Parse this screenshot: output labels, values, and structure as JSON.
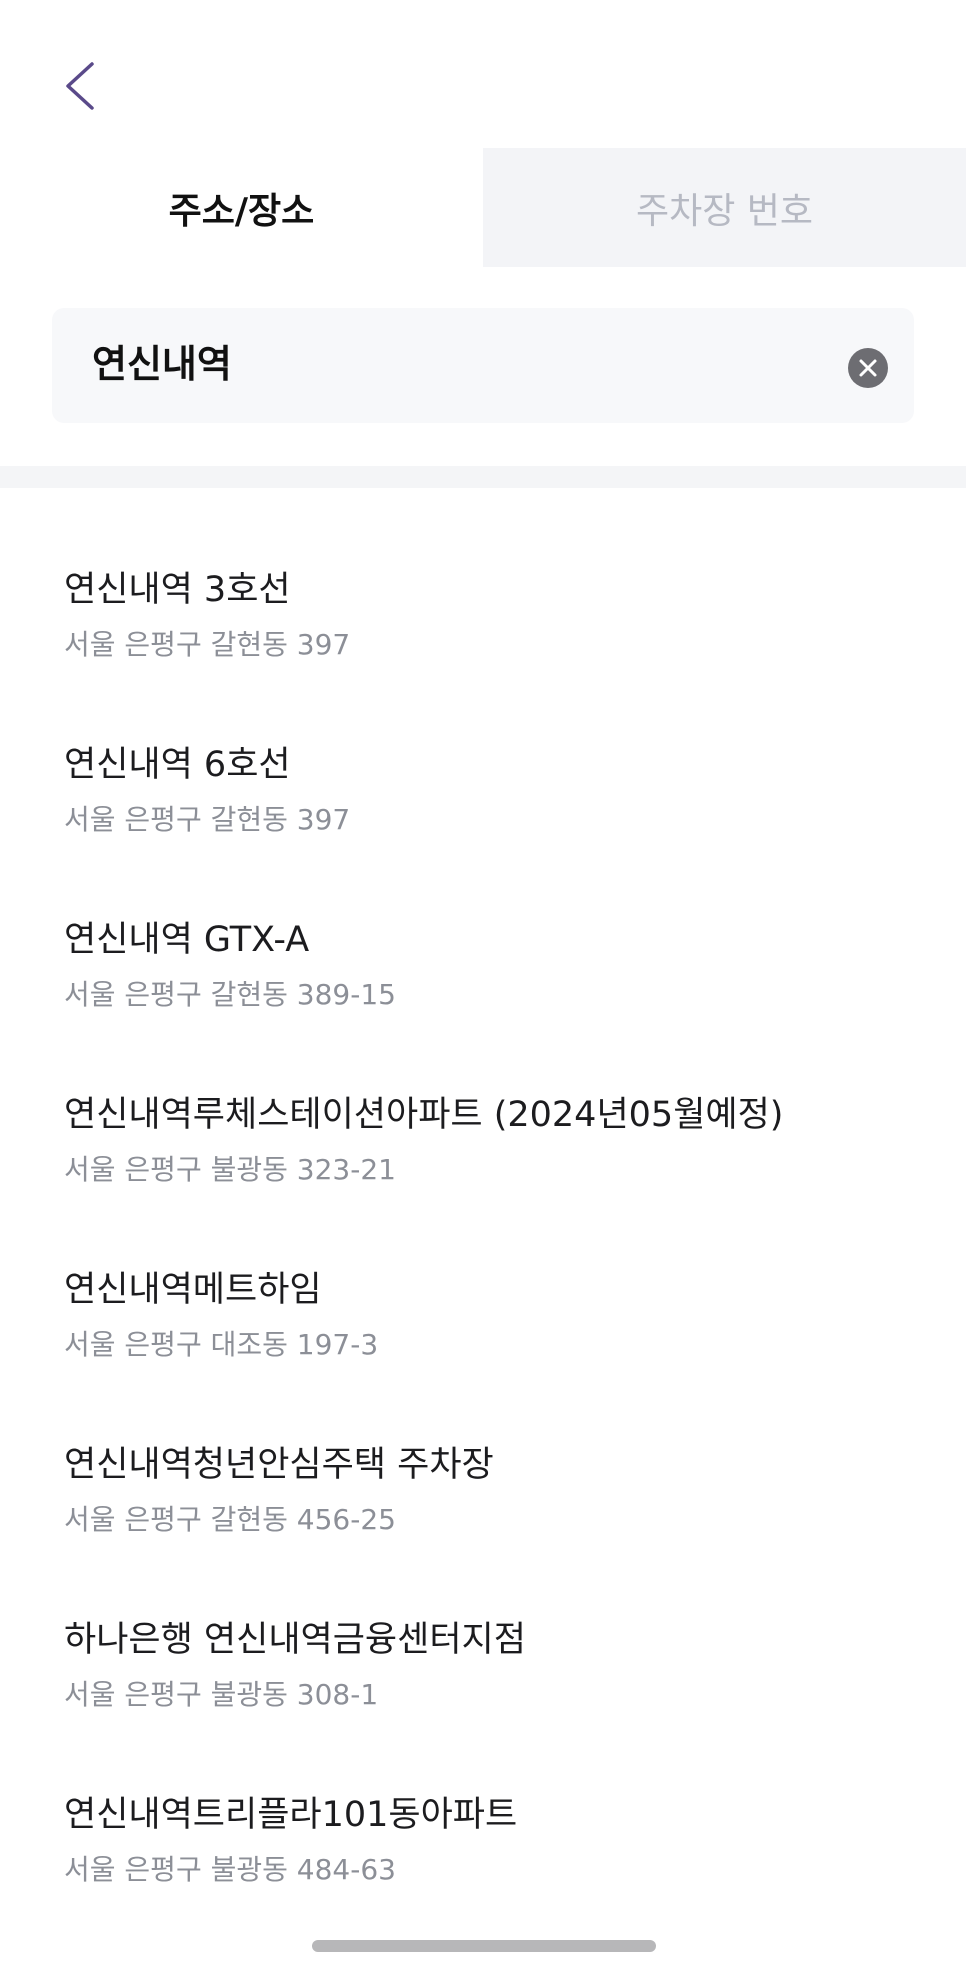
{
  "tabs": [
    {
      "label": "주소/장소",
      "active": true
    },
    {
      "label": "주차장 번호",
      "active": false
    }
  ],
  "search": {
    "value": "연신내역"
  },
  "results": [
    {
      "name": "연신내역 3호선",
      "address": "서울 은평구 갈현동 397"
    },
    {
      "name": "연신내역 6호선",
      "address": "서울 은평구 갈현동 397"
    },
    {
      "name": "연신내역 GTX-A",
      "address": "서울 은평구 갈현동 389-15"
    },
    {
      "name": "연신내역루체스테이션아파트 (2024년05월예정)",
      "address": "서울 은평구 불광동 323-21"
    },
    {
      "name": "연신내역메트하임",
      "address": "서울 은평구 대조동 197-3"
    },
    {
      "name": "연신내역청년안심주택 주차장",
      "address": "서울 은평구 갈현동 456-25"
    },
    {
      "name": "하나은행 연신내역금융센터지점",
      "address": "서울 은평구 불광동 308-1"
    },
    {
      "name": "연신내역트리플라101동아파트",
      "address": "서울 은평구 불광동 484-63"
    }
  ],
  "colors": {
    "accent": "#5a4a8a",
    "clear_icon_bg": "#6d6d72"
  },
  "icons": {
    "back": "chevron-left-icon",
    "clear": "clear-icon"
  }
}
